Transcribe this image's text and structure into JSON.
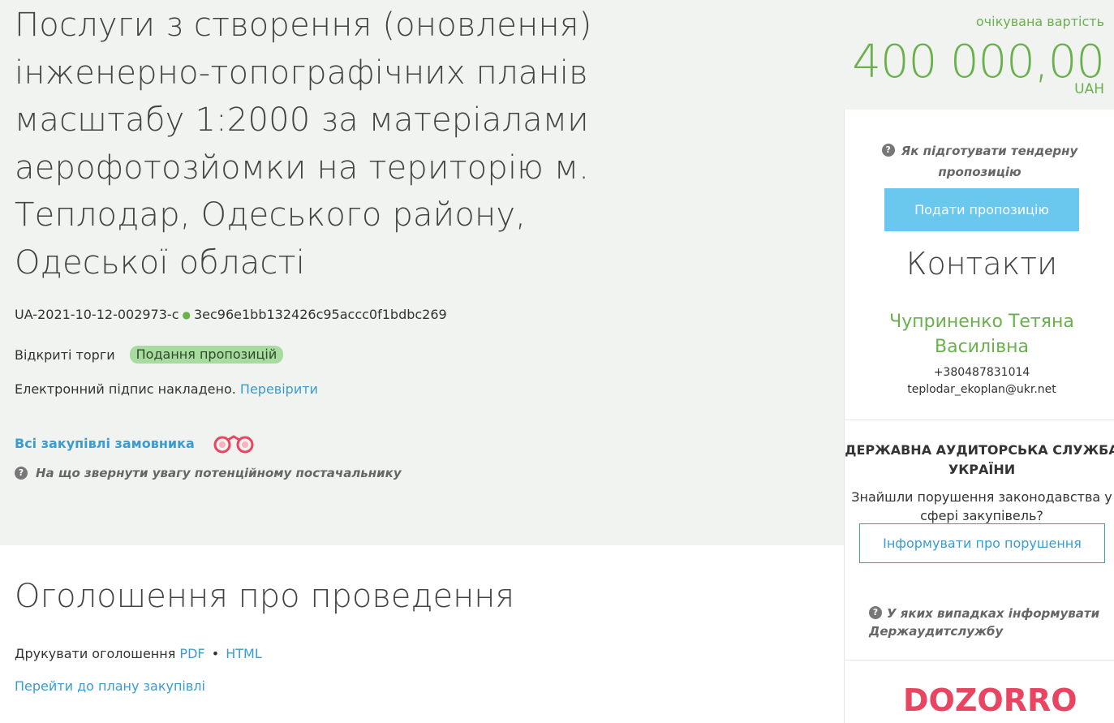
{
  "tender": {
    "title": "Послуги з створення (оновлення) інженерно-топографічних планів масштабу 1:2000 за матеріалами аерофотозйомки на територію м. Теплодар, Одеського району, Одеської області",
    "id": "UA-2021-10-12-002973-c",
    "hash": "3ec96e1bb132426c95accc0f1bdbc269",
    "procedure": "Відкриті торги",
    "status": "Подання пропозицій",
    "signature_text": "Електронний підпис накладено.",
    "signature_link": "Перевірити",
    "all_buyer_link": "Всі закупівлі замовника",
    "attention_text": "На що звернути увагу потенційному постачальнику"
  },
  "price": {
    "label": "очікувана вартість",
    "value": "400 000,00",
    "currency": "UAH"
  },
  "sidebar": {
    "how_to_prepare": "Як підготувати тендерну пропозицію",
    "submit_button": "Подати пропозицію",
    "contacts_heading": "Контакти",
    "contact_name": "Чуприненко Тетяна Василівна",
    "contact_phone": "+380487831014",
    "contact_email": "teplodar_ekoplan@ukr.net",
    "audit_heading": "ДЕРЖАВНА АУДИТОРСЬКА СЛУЖБА УКРАЇНИ",
    "audit_question": "Знайшли порушення законодавства у сфері закупівель?",
    "report_button": "Інформувати про порушення",
    "when_to_report": "У яких випадках інформувати Держаудитслужбу",
    "dozorro_logo": "DOZORRO"
  },
  "announcement": {
    "heading": "Оголошення про проведення",
    "print_label": "Друкувати оголошення",
    "pdf": "PDF",
    "sep": "•",
    "html": "HTML",
    "plan_link": "Перейти до плану закупівлі"
  },
  "colors": {
    "accent_green": "#6ab04c",
    "link_blue": "#3a9cd1",
    "button_blue": "#6ac7ee",
    "dozorro_red": "#e94560"
  }
}
